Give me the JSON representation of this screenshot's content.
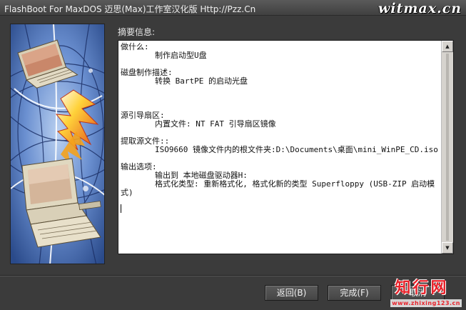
{
  "window": {
    "title": "FlashBoot For MaxDOS 迈思(Max)工作室汉化版 Http://Pzz.Cn",
    "watermark_top": "witmax.cn"
  },
  "summary": {
    "label": "摘要信息:",
    "sections": [
      {
        "heading": "做什么:",
        "lines": [
          "制作启动型U盘"
        ]
      },
      {
        "heading": "磁盘制作描述:",
        "lines": [
          "转换 BartPE 的启动光盘"
        ]
      },
      {
        "heading": "源引导扇区:",
        "lines": [
          "内置文件: NT FAT 引导扇区镜像"
        ]
      },
      {
        "heading": "提取源文件::",
        "lines": [
          "ISO9660 镜像文件内的根文件夹:D:\\Documents\\桌面\\mini_WinPE_CD.iso"
        ]
      },
      {
        "heading": "输出选项:",
        "lines": [
          "输出到 本地磁盘驱动器H:",
          "格式化类型: 重新格式化, 格式化新的类型 Superfloppy (USB-ZIP 启动模式)"
        ]
      }
    ]
  },
  "buttons": {
    "back": "返回(B)",
    "finish": "完成(F)",
    "cancel": "取消"
  },
  "brand": {
    "name": "知行网",
    "url": "www.zhixing123.cn"
  },
  "colors": {
    "background": "#3b3b3b",
    "text_box": "#ffffff",
    "brand_red": "#e8232b"
  }
}
